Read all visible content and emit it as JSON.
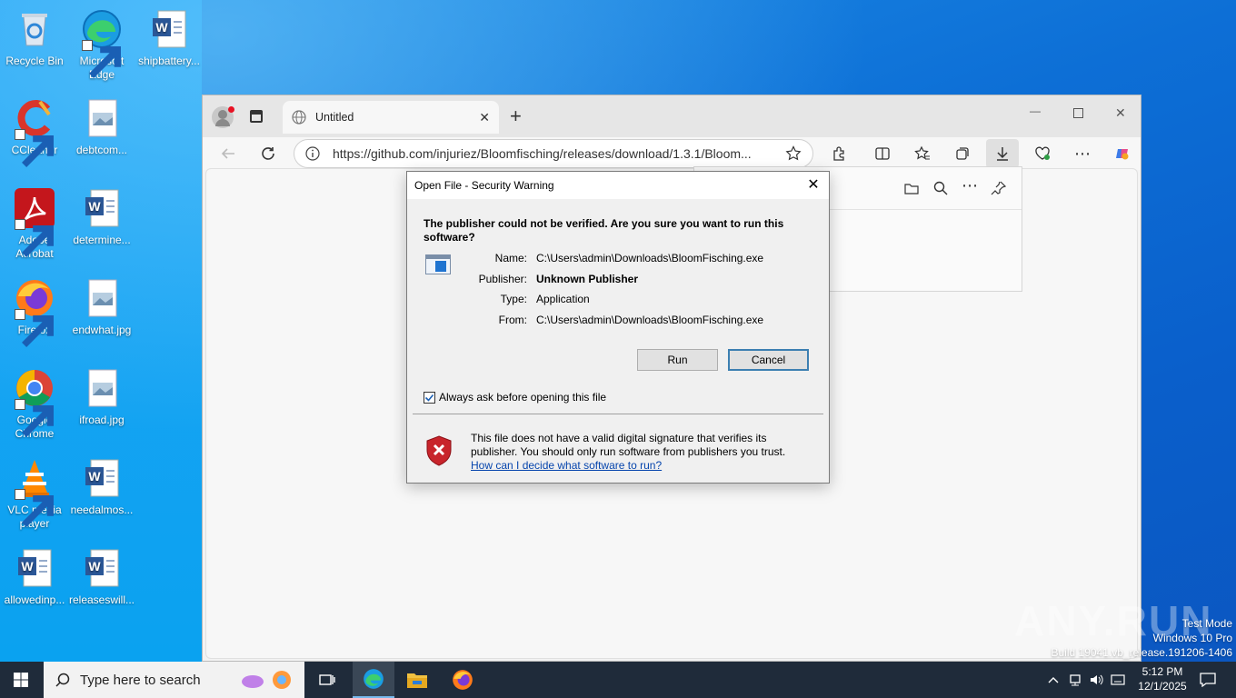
{
  "desktop": {
    "icons": [
      {
        "label": "Recycle Bin",
        "icon": "recycle-bin-icon"
      },
      {
        "label": "Microsoft Edge",
        "icon": "edge-icon"
      },
      {
        "label": "shipbattery...",
        "icon": "word-doc-icon"
      },
      {
        "label": "CCleaner",
        "icon": "ccleaner-icon"
      },
      {
        "label": "debtcom...",
        "icon": "image-file-icon"
      },
      {
        "label": "Adobe Acrobat",
        "icon": "acrobat-icon"
      },
      {
        "label": "determine...",
        "icon": "word-doc-icon"
      },
      {
        "label": "Firefox",
        "icon": "firefox-icon"
      },
      {
        "label": "endwhat.jpg",
        "icon": "image-file-icon"
      },
      {
        "label": "Google Chrome",
        "icon": "chrome-icon"
      },
      {
        "label": "ifroad.jpg",
        "icon": "image-file-icon"
      },
      {
        "label": "VLC media player",
        "icon": "vlc-icon"
      },
      {
        "label": "needalmos...",
        "icon": "word-doc-icon"
      },
      {
        "label": "allowedinp...",
        "icon": "word-doc-icon"
      },
      {
        "label": "releaseswill...",
        "icon": "word-doc-icon"
      }
    ]
  },
  "browser": {
    "tab_title": "Untitled",
    "address": "https://github.com/injuriez/Bloomfisching/releases/download/1.3.1/Bloom...",
    "new_tab": "+",
    "minimize": "—",
    "close": "✕"
  },
  "dialog": {
    "title": "Open File - Security Warning",
    "heading": "The publisher could not be verified.  Are you sure you want to run this software?",
    "fields": [
      {
        "label": "Name:",
        "value": "C:\\Users\\admin\\Downloads\\BloomFisching.exe"
      },
      {
        "label": "Publisher:",
        "value": "Unknown Publisher"
      },
      {
        "label": "Type:",
        "value": "Application"
      },
      {
        "label": "From:",
        "value": "C:\\Users\\admin\\Downloads\\BloomFisching.exe"
      }
    ],
    "run_label": "Run",
    "cancel_label": "Cancel",
    "checkbox_label": "Always ask before opening this file",
    "checkbox_checked": true,
    "warning_text": "This file does not have a valid digital signature that verifies its publisher.  You should only run software from publishers you trust.",
    "warning_link": "How can I decide what software to run?"
  },
  "taskbar": {
    "search_placeholder": "Type here to search",
    "time": "5:12 PM",
    "date": "12/1/2025"
  },
  "watermark": {
    "line1": "Test Mode",
    "line2": "Windows 10 Pro",
    "line3": "Build 19041.vb_release.191206-1406",
    "brand": "ANY.RUN"
  },
  "colors": {
    "accent_blue": "#0078d4",
    "dialog_bg": "#f0f0f0",
    "taskbar_bg": "#1f2b3a"
  }
}
